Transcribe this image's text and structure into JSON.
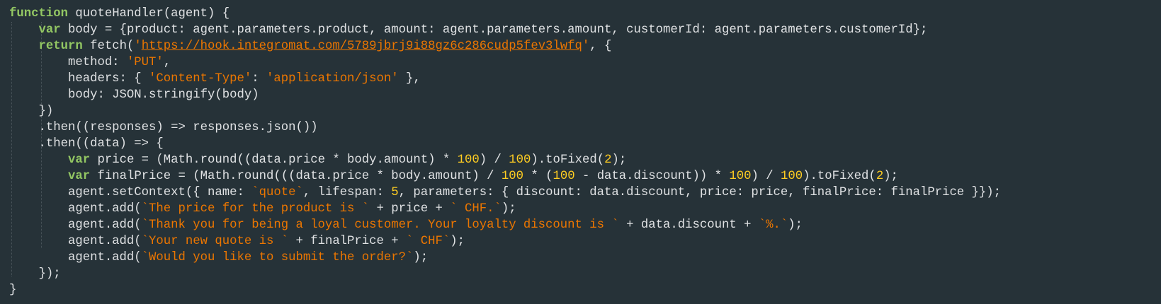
{
  "editor": {
    "lines": [
      [
        {
          "t": "kw",
          "v": "function"
        },
        {
          "t": "plain",
          "v": " quoteHandler(agent) {"
        }
      ],
      [
        {
          "t": "plain",
          "v": "    "
        },
        {
          "t": "kw",
          "v": "var"
        },
        {
          "t": "plain",
          "v": " body = {product: agent.parameters.product, amount: agent.parameters.amount, customerId: agent.parameters.customerId};"
        }
      ],
      [
        {
          "t": "plain",
          "v": "    "
        },
        {
          "t": "kw",
          "v": "return"
        },
        {
          "t": "plain",
          "v": " fetch("
        },
        {
          "t": "str",
          "v": "'"
        },
        {
          "t": "url",
          "v": "https://hook.integromat.com/5789jbrj9i88gz6c286cudp5fev3lwfq"
        },
        {
          "t": "str",
          "v": "'"
        },
        {
          "t": "plain",
          "v": ", {"
        }
      ],
      [
        {
          "t": "plain",
          "v": "        method: "
        },
        {
          "t": "str",
          "v": "'PUT'"
        },
        {
          "t": "plain",
          "v": ","
        }
      ],
      [
        {
          "t": "plain",
          "v": "        headers: { "
        },
        {
          "t": "str",
          "v": "'Content-Type'"
        },
        {
          "t": "plain",
          "v": ": "
        },
        {
          "t": "str",
          "v": "'application/json'"
        },
        {
          "t": "plain",
          "v": " },"
        }
      ],
      [
        {
          "t": "plain",
          "v": "        body: JSON.stringify(body)"
        }
      ],
      [
        {
          "t": "plain",
          "v": "    })"
        }
      ],
      [
        {
          "t": "plain",
          "v": "    .then((responses) => responses.json())"
        }
      ],
      [
        {
          "t": "plain",
          "v": "    .then((data) => {"
        }
      ],
      [
        {
          "t": "plain",
          "v": "        "
        },
        {
          "t": "kw",
          "v": "var"
        },
        {
          "t": "plain",
          "v": " price = (Math.round((data.price * body.amount) * "
        },
        {
          "t": "num",
          "v": "100"
        },
        {
          "t": "plain",
          "v": ") / "
        },
        {
          "t": "num",
          "v": "100"
        },
        {
          "t": "plain",
          "v": ").toFixed("
        },
        {
          "t": "num",
          "v": "2"
        },
        {
          "t": "plain",
          "v": ");"
        }
      ],
      [
        {
          "t": "plain",
          "v": "        "
        },
        {
          "t": "kw",
          "v": "var"
        },
        {
          "t": "plain",
          "v": " finalPrice = (Math.round(((data.price * body.amount) / "
        },
        {
          "t": "num",
          "v": "100"
        },
        {
          "t": "plain",
          "v": " * ("
        },
        {
          "t": "num",
          "v": "100"
        },
        {
          "t": "plain",
          "v": " - data.discount)) * "
        },
        {
          "t": "num",
          "v": "100"
        },
        {
          "t": "plain",
          "v": ") / "
        },
        {
          "t": "num",
          "v": "100"
        },
        {
          "t": "plain",
          "v": ").toFixed("
        },
        {
          "t": "num",
          "v": "2"
        },
        {
          "t": "plain",
          "v": ");"
        }
      ],
      [
        {
          "t": "plain",
          "v": "        agent.setContext({ name: "
        },
        {
          "t": "str",
          "v": "`quote`"
        },
        {
          "t": "plain",
          "v": ", lifespan: "
        },
        {
          "t": "num",
          "v": "5"
        },
        {
          "t": "plain",
          "v": ", parameters: { discount: data.discount, price: price, finalPrice: finalPrice }});"
        }
      ],
      [
        {
          "t": "plain",
          "v": "        agent.add("
        },
        {
          "t": "str",
          "v": "`The price for the product is `"
        },
        {
          "t": "plain",
          "v": " + price + "
        },
        {
          "t": "str",
          "v": "` CHF.`"
        },
        {
          "t": "plain",
          "v": ");"
        }
      ],
      [
        {
          "t": "plain",
          "v": "        agent.add("
        },
        {
          "t": "str",
          "v": "`Thank you for being a loyal customer. Your loyalty discount is `"
        },
        {
          "t": "plain",
          "v": " + data.discount + "
        },
        {
          "t": "str",
          "v": "`%.`"
        },
        {
          "t": "plain",
          "v": ");"
        }
      ],
      [
        {
          "t": "plain",
          "v": "        agent.add("
        },
        {
          "t": "str",
          "v": "`Your new quote is `"
        },
        {
          "t": "plain",
          "v": " + finalPrice + "
        },
        {
          "t": "str",
          "v": "` CHF`"
        },
        {
          "t": "plain",
          "v": ");"
        }
      ],
      [
        {
          "t": "plain",
          "v": "        agent.add("
        },
        {
          "t": "str",
          "v": "`Would you like to submit the order?`"
        },
        {
          "t": "plain",
          "v": ");"
        }
      ],
      [
        {
          "t": "plain",
          "v": "    });"
        }
      ],
      [
        {
          "t": "plain",
          "v": "}"
        }
      ]
    ]
  },
  "colors": {
    "background": "#263238",
    "keyword": "#93c763",
    "string": "#ec7600",
    "number": "#ffcd22",
    "plain": "#e0e2e4"
  }
}
